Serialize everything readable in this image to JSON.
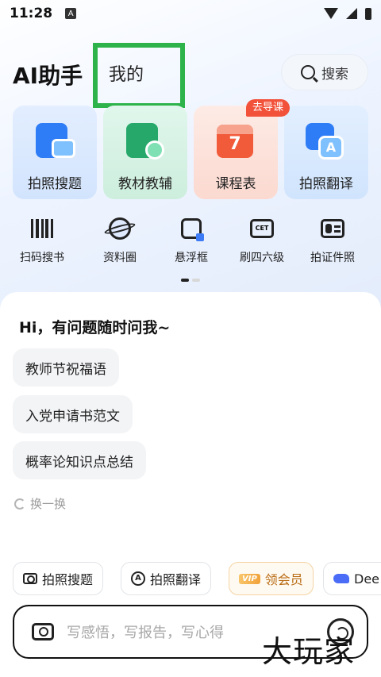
{
  "status_bar": {
    "time": "11:28",
    "notification_badge": "A"
  },
  "header": {
    "app_title": "AI助手",
    "tab_mine": "我的",
    "search_label": "搜索",
    "highlight_color": "#2db34a"
  },
  "feature_cards": [
    {
      "label": "拍照搜题",
      "icon": "photo-search-icon"
    },
    {
      "label": "教材教辅",
      "icon": "textbook-icon"
    },
    {
      "label": "课程表",
      "icon": "calendar-icon",
      "icon_text": "7",
      "badge": "去导课"
    },
    {
      "label": "拍照翻译",
      "icon": "photo-translate-icon",
      "icon_text": "A"
    }
  ],
  "tools": [
    {
      "label": "扫码搜书",
      "icon": "barcode-icon"
    },
    {
      "label": "资料圈",
      "icon": "planet-icon"
    },
    {
      "label": "悬浮框",
      "icon": "floating-frame-icon"
    },
    {
      "label": "刷四六级",
      "icon": "cet-icon",
      "icon_text": "CET"
    },
    {
      "label": "拍证件照",
      "icon": "id-photo-icon"
    }
  ],
  "chat": {
    "greeting": "Hi，有问题随时问我~",
    "suggestions": [
      "教师节祝福语",
      "入党申请书范文",
      "概率论知识点总结"
    ],
    "refresh_label": "换一换"
  },
  "quick_chips": [
    {
      "label": "拍照搜题",
      "icon": "camera-icon"
    },
    {
      "label": "拍照翻译",
      "icon": "translate-icon"
    },
    {
      "label": "领会员",
      "icon": "vip-icon",
      "tag": "VIP"
    },
    {
      "label": "Dee",
      "icon": "deepseek-whale-icon"
    }
  ],
  "input": {
    "placeholder": "写感悟，写报告，写心得"
  },
  "watermark": "大玩家"
}
